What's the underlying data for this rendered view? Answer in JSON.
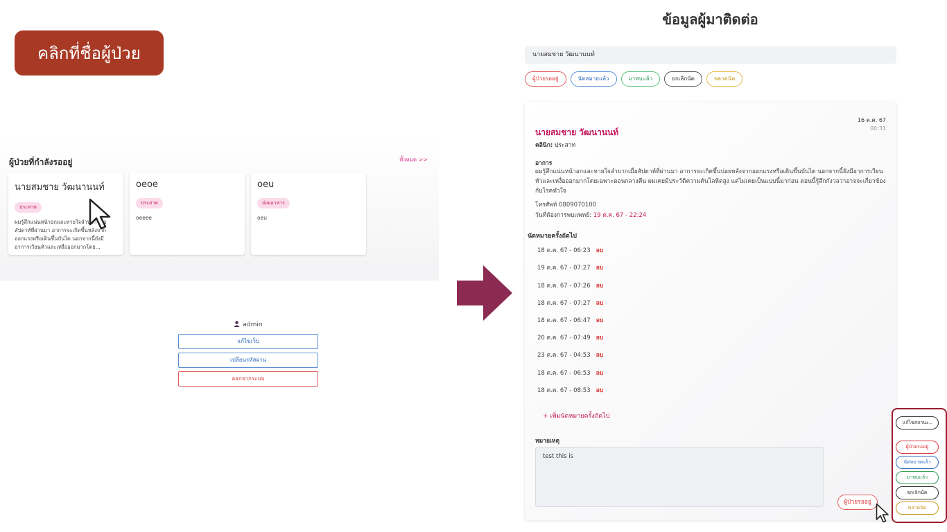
{
  "hint_label": "คลิกที่ชื่อผู้ป่วย",
  "waiting": {
    "title": "ผู้ป่วยที่กำลังรออยู่",
    "see_all": "ทั้งหมด >>",
    "cards": [
      {
        "name": "นายสมชาย วัฒนานนท์",
        "tag": "ประสาท",
        "desc": "ผมรู้สึกแน่นหน้าอกและหายใจลำบาก เมื่อสัปดาห์ที่ผ่านมา อาการจะเกิดขึ้นหลังจากออกแรงหรือเดินขึ้นบันได นอกจากนี้ยังมีอาการเวียนหัวและเหงื่อออกมากโดย..."
      },
      {
        "name": "oeoe",
        "tag": "ประสาท",
        "desc": "oeeee"
      },
      {
        "name": "oeu",
        "tag": "ย่อยอาหาร",
        "desc": "oeu"
      }
    ]
  },
  "admin": {
    "username": "admin",
    "buttons": {
      "edit": "แก้ไขเว็บ",
      "password": "เปลี่ยนรหัสผ่าน",
      "logout": "ออกจากระบบ"
    }
  },
  "detail_panel": {
    "title": "ข้อมูลผู้มาติดต่อ",
    "search_value": "นายสมชาย วัฒนานนท์",
    "filters": [
      "ผู้ป่วยรออยู่",
      "นัดหมายแล้ว",
      "มาพบแล้ว",
      "ยกเลิกนัด",
      "พลาดนัด"
    ],
    "date": "16 ต.ค. 67",
    "time": "00:31",
    "name": "นายสมชาย วัฒนานนท์",
    "clinic_label": "คลินิก:",
    "clinic_value": "ประสาท",
    "symptom_label": "อาการ",
    "symptom_text": "ผมรู้สึกแน่นหน้าอกและหายใจลำบากเมื่อสัปดาห์ที่ผ่านมา อาการจะเกิดขึ้นบ่อยหลังจากออกแรงหรือเดินขึ้นบันได นอกจากนี้ยังมีอาการเวียนหัวและเหงื่อออกมากโดยเฉพาะตอนกลางคืน ผมเคยมีประวัติความดันโลหิตสูง แต่ไม่เคยเป็นแบบนี้มาก่อน ตอนนี้รู้สึกกังวลว่าอาจจะเกี่ยวข้องกับโรคหัวใจ",
    "phone_label": "โทรศัพท์",
    "phone_value": "0809070100",
    "want_label": "วันที่ต้องการพบแพทย์:",
    "want_value": "19 ต.ค. 67 - 22:24",
    "appointments_label": "นัดหมายครั้งถัดไป",
    "appointments": [
      "18 ต.ค. 67 - 06:23",
      "19 ต.ค. 67 - 07:27",
      "18 ต.ค. 67 - 07:26",
      "18 ต.ค. 67 - 07:27",
      "18 ต.ค. 67 - 06:47",
      "20 ต.ค. 67 - 07:49",
      "23 ต.ค. 67 - 04:53",
      "18 ต.ค. 67 - 06:53",
      "18 ต.ค. 67 - 08:53"
    ],
    "delete_label": "ลบ",
    "add_appointment": "+ เพิ่มนัดหมายครั้งถัดไป",
    "note_label": "หมายเหตุ",
    "note_value": "test this is",
    "status_current": "ผู้ป่วยรออยู่"
  },
  "status_menu": {
    "edit": "แก้ไขสถานะ..",
    "options": [
      "ผู้ป่วยรออยู่",
      "นัดหมายแล้ว",
      "มาพบแล้ว",
      "ยกเลิกนัด",
      "พลาดนัด"
    ]
  },
  "colors": {
    "accent": "#c2185b",
    "hint_bg": "#a83a25",
    "arrow": "#8b2a52",
    "menu_border": "#9b1c2e"
  }
}
